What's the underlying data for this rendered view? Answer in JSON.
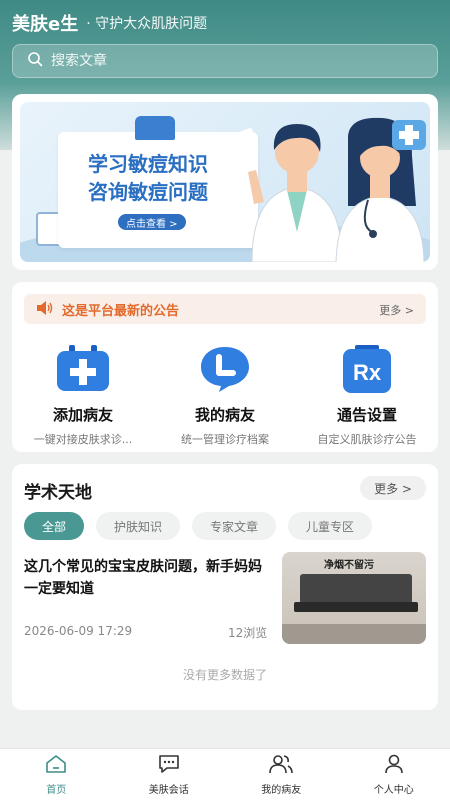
{
  "header": {
    "brand": "美肤e生",
    "slogan": "· 守护大众肌肤问题"
  },
  "search": {
    "placeholder": "搜索文章"
  },
  "banner": {
    "title_line1": "学习敏痘知识",
    "title_line2": "咨询敏痘问题",
    "button": "点击查看 >"
  },
  "notice": {
    "text": "这是平台最新的公告",
    "more": "更多 >"
  },
  "quick_actions": [
    {
      "title": "添加病友",
      "subtitle": "一键对接皮肤求诊...",
      "icon": "add-patient-icon"
    },
    {
      "title": "我的病友",
      "subtitle": "统一管理诊疗档案",
      "icon": "chat-bubble-icon"
    },
    {
      "title": "通告设置",
      "subtitle": "自定义肌肤诊疗公告",
      "icon": "rx-icon"
    }
  ],
  "academic": {
    "title": "学术天地",
    "more": "更多 >",
    "chips": [
      "全部",
      "护肤知识",
      "专家文章",
      "儿童专区"
    ],
    "active_chip": "全部",
    "article": {
      "title": "这几个常见的宝宝皮肤问题，新手妈妈一定要知道",
      "date": "2026-06-09 17:29",
      "views": "12浏览",
      "thumb_text": "净烟不留污"
    },
    "no_more": "没有更多数据了"
  },
  "tabbar": {
    "items": [
      {
        "label": "首页",
        "icon": "home-icon",
        "active": true
      },
      {
        "label": "美肤会话",
        "icon": "message-icon",
        "active": false
      },
      {
        "label": "我的病友",
        "icon": "patients-icon",
        "active": false
      },
      {
        "label": "个人中心",
        "icon": "profile-icon",
        "active": false
      }
    ]
  },
  "colors": {
    "primary": "#4a9893",
    "notice_orange": "#e36a2d",
    "icon_blue": "#2f7ee0"
  }
}
